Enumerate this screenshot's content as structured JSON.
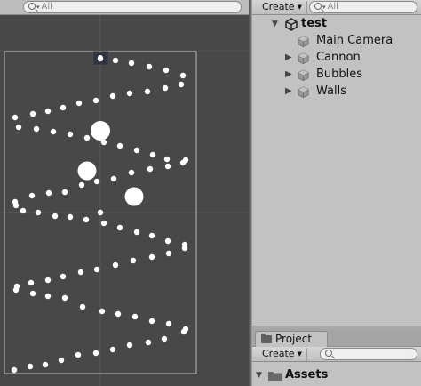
{
  "scene_view": {
    "search_placeholder": "All"
  },
  "hierarchy": {
    "create_label": "Create",
    "search_placeholder": "All",
    "scene_name": "test",
    "items": [
      {
        "label": "Main Camera",
        "expandable": false
      },
      {
        "label": "Cannon",
        "expandable": true
      },
      {
        "label": "Bubbles",
        "expandable": true
      },
      {
        "label": "Walls",
        "expandable": true
      }
    ]
  },
  "project": {
    "tab_label": "Project",
    "create_label": "Create",
    "assets_label": "Assets"
  },
  "colors": {
    "scene_background": "#484848",
    "panel_background": "#c2c2c2",
    "bubble": "#ffffff",
    "camera_bounds": "#bcbcbc"
  },
  "icons": [
    "search-icon",
    "unity-logo-icon",
    "gameobject-cube-icon",
    "expand-arrow-icon",
    "folder-icon",
    "camera-gizmo-icon"
  ]
}
